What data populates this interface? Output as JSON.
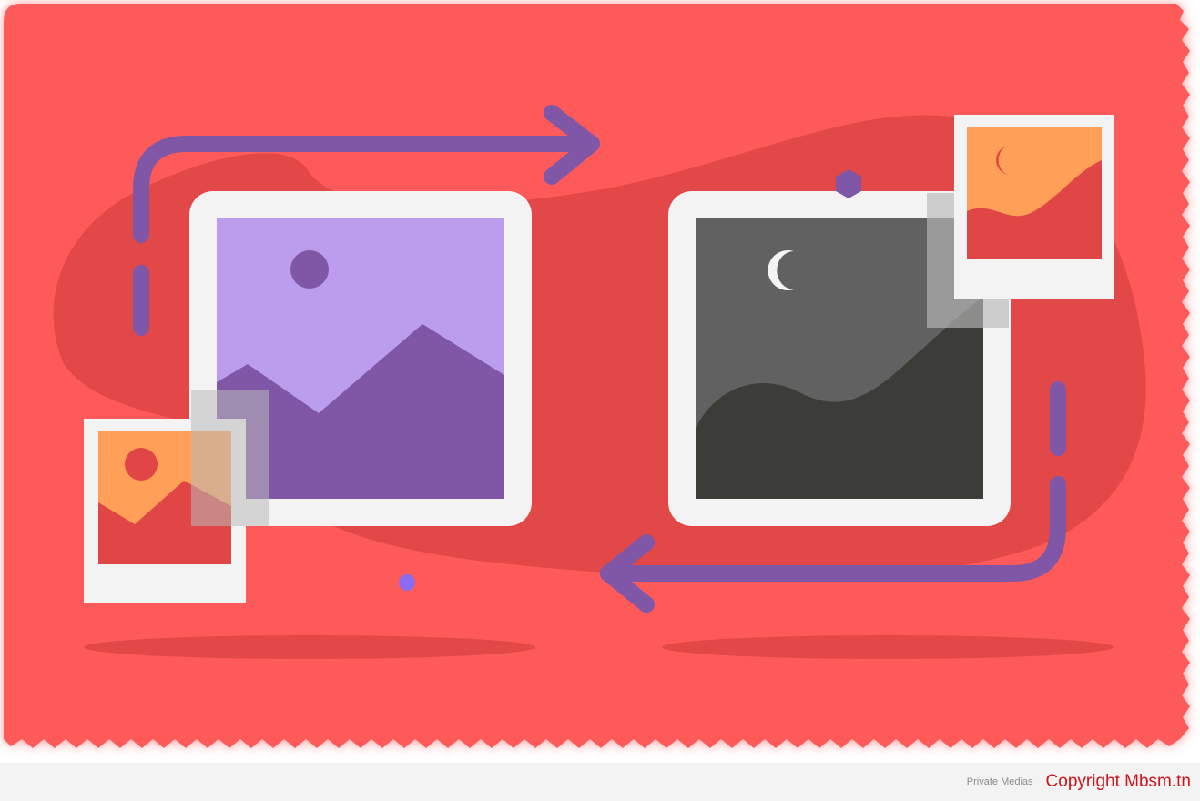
{
  "footer": {
    "source_label": "Private Medias",
    "copyright_label": "Copyright Mbsm.tn"
  },
  "illustration": {
    "subject": "image conversion: color photo to dark-mode photo",
    "colors": {
      "background": "#ff5a5a",
      "blob": "#e24848",
      "purple_arrow": "#7f57a6",
      "frame_white": "#f3f3f3",
      "lavender_sky": "#bc9cec",
      "dark_sky": "#616161",
      "dark_ground": "#3c3c38",
      "orange": "#ff9f58",
      "red_ground": "#e04646",
      "tape": "#b9b9b9"
    }
  }
}
